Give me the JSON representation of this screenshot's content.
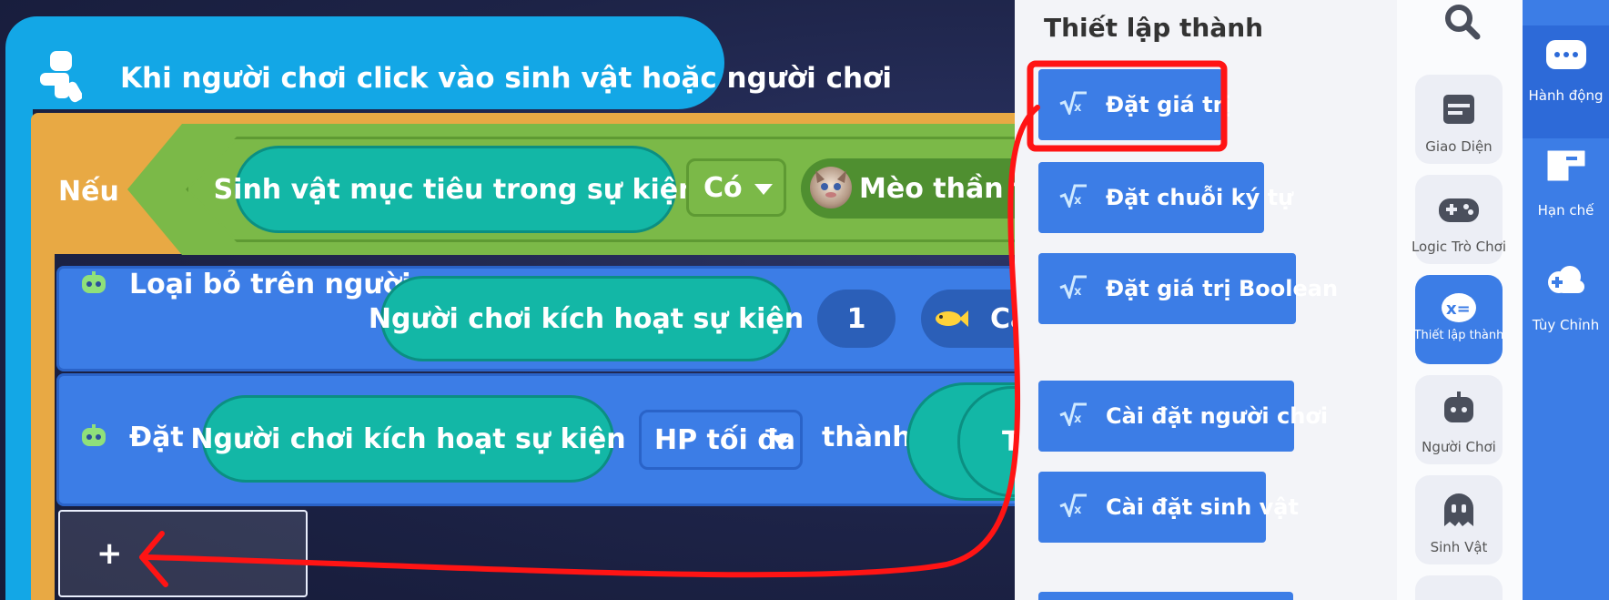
{
  "event_block": {
    "label": "Khi người chơi click vào sinh vật hoặc người chơi",
    "color": "#13a7e6"
  },
  "if_block": {
    "label": "Nếu",
    "color": "#e8a944",
    "condition": {
      "target": "Sinh vật mục tiêu trong sự kiện",
      "operator": "Có",
      "creature": "Mèo thần tài"
    }
  },
  "actions": [
    {
      "label": "Loại bỏ trên người",
      "target": "Người chơi kích hoạt sự kiện",
      "amount": "1",
      "item": "Cá"
    },
    {
      "label": "Đặt",
      "target": "Người chơi kích hoạt sự kiện",
      "property": "HP tối đa",
      "connector": "thành",
      "value": "T"
    }
  ],
  "add_button": {
    "label": "+"
  },
  "panel": {
    "title": "Thiết lập thành",
    "buttons": [
      {
        "label": "Đặt giá trị",
        "highlighted": true
      },
      {
        "label": "Đặt chuỗi ký tự"
      },
      {
        "label": "Đặt giá trị Boolean"
      },
      {
        "label": "Cài đặt người chơi"
      },
      {
        "label": "Cài đặt sinh vật"
      }
    ]
  },
  "categories": {
    "search_icon": "search-icon",
    "items": [
      {
        "label": "Giao Diện",
        "icon": "window-icon"
      },
      {
        "label": "Logic Trò Chơi",
        "icon": "gamepad-icon"
      },
      {
        "label": "Thiết lập thành",
        "icon": "set-value-icon",
        "active": true
      },
      {
        "label": "Người Chơi",
        "icon": "robot-icon"
      },
      {
        "label": "Sinh Vật",
        "icon": "ghost-icon"
      }
    ]
  },
  "nav": {
    "items": [
      {
        "label": "Hành động",
        "icon": "chat-dots-icon",
        "active": true
      },
      {
        "label": "Hạn chế",
        "icon": "puzzle-icon"
      },
      {
        "label": "Tùy Chỉnh",
        "icon": "cloud-plus-icon"
      }
    ]
  },
  "annotation": {
    "color": "#ff1414"
  },
  "colors": {
    "action_blue": "#3c7de6",
    "teal": "#13b7a6",
    "condition_green": "#7bb948"
  }
}
